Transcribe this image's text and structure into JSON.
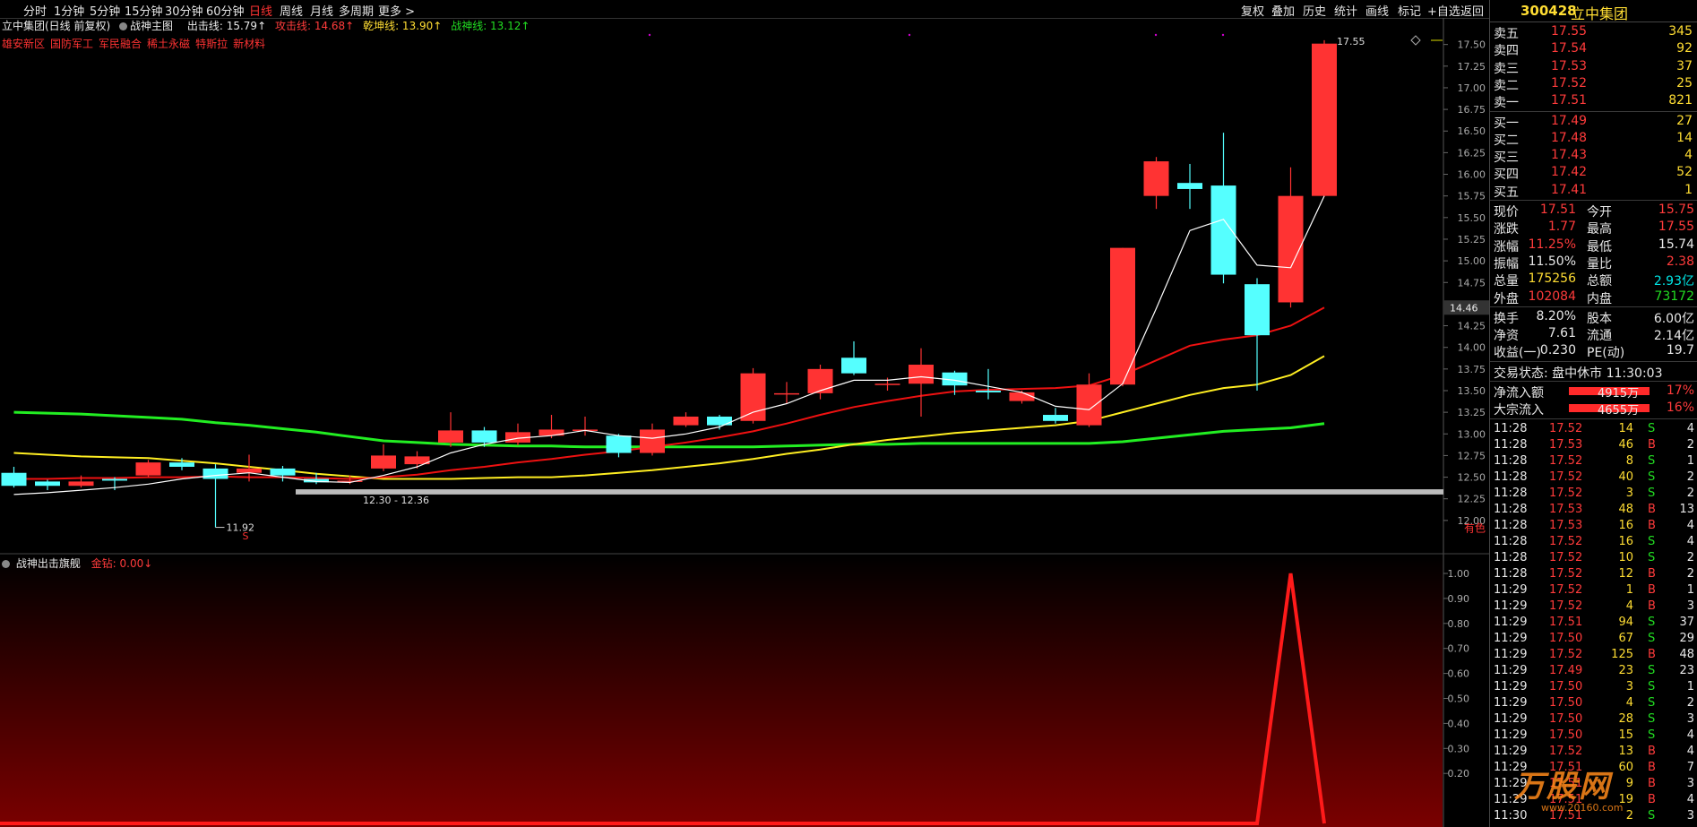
{
  "toolbar": {
    "tabs": [
      {
        "label": "分时",
        "active": false
      },
      {
        "label": "1分钟",
        "active": false
      },
      {
        "label": "5分钟",
        "active": false
      },
      {
        "label": "15分钟",
        "active": false
      },
      {
        "label": "30分钟",
        "active": false
      },
      {
        "label": "60分钟",
        "active": false
      },
      {
        "label": "日线",
        "active": true
      },
      {
        "label": "周线",
        "active": false
      },
      {
        "label": "月线",
        "active": false
      },
      {
        "label": "多周期",
        "active": false
      },
      {
        "label": "更多 >",
        "active": false
      }
    ],
    "tools": [
      "复权",
      "叠加",
      "历史",
      "统计",
      "画线",
      "标记",
      "+自选",
      "返回"
    ]
  },
  "main_chart": {
    "title": "立中集团(日线 前复权)",
    "indicator": "战神主图",
    "attack_label": "出击线: 15.79↑",
    "offense_label": "攻击线: 14.68↑",
    "qiankun_label": "乾坤线: 13.90↑",
    "zhanshen_label": "战神线: 13.12↑",
    "concepts": [
      "雄安新区",
      "国防军工",
      "军民融合",
      "稀土永磁",
      "特斯拉",
      "新材料"
    ],
    "high_label": "17.55",
    "low_label": "11.92",
    "range_label": "12.30 - 12.36",
    "current_tag": "14.46",
    "corner_label": "有色",
    "s_marker": "S"
  },
  "sub_chart": {
    "title": "战神出击旗舰",
    "value_label": "金钻: 0.00↓",
    "axis": [
      "1.00",
      "0.90",
      "0.80",
      "0.70",
      "0.60",
      "0.50",
      "0.40",
      "0.30",
      "0.20"
    ]
  },
  "colors": {
    "up": "#ff3333",
    "down": "#55ffff",
    "ma_white": "#ffffff",
    "ma_red": "#ee1111",
    "ma_yellow": "#ffee22",
    "ma_green": "#22ee22"
  },
  "chart_data": {
    "type": "candlestick",
    "ylim": [
      11.75,
      17.6
    ],
    "yticks": [
      "17.50",
      "17.25",
      "17.00",
      "16.75",
      "16.50",
      "16.25",
      "16.00",
      "15.75",
      "15.50",
      "15.25",
      "15.00",
      "14.75",
      "14.50",
      "14.25",
      "14.00",
      "13.75",
      "13.50",
      "13.25",
      "13.00",
      "12.75",
      "12.50",
      "12.25",
      "12.00"
    ],
    "candles": [
      {
        "o": 12.55,
        "c": 12.4,
        "h": 12.62,
        "l": 12.38
      },
      {
        "o": 12.45,
        "c": 12.4,
        "h": 12.47,
        "l": 12.35
      },
      {
        "o": 12.4,
        "c": 12.45,
        "h": 12.52,
        "l": 12.38
      },
      {
        "o": 12.48,
        "c": 12.46,
        "h": 12.5,
        "l": 12.35
      },
      {
        "o": 12.52,
        "c": 12.67,
        "h": 12.7,
        "l": 12.5
      },
      {
        "o": 12.67,
        "c": 12.62,
        "h": 12.72,
        "l": 12.58
      },
      {
        "o": 12.6,
        "c": 12.48,
        "h": 12.65,
        "l": 11.92
      },
      {
        "o": 12.55,
        "c": 12.6,
        "h": 12.76,
        "l": 12.45
      },
      {
        "o": 12.6,
        "c": 12.52,
        "h": 12.63,
        "l": 12.45
      },
      {
        "o": 12.48,
        "c": 12.44,
        "h": 12.55,
        "l": 12.42
      },
      {
        "o": 12.46,
        "c": 12.46,
        "h": 12.52,
        "l": 12.42
      },
      {
        "o": 12.6,
        "c": 12.75,
        "h": 12.88,
        "l": 12.57
      },
      {
        "o": 12.65,
        "c": 12.74,
        "h": 12.8,
        "l": 12.6
      },
      {
        "o": 12.9,
        "c": 13.04,
        "h": 13.25,
        "l": 12.85
      },
      {
        "o": 13.04,
        "c": 12.9,
        "h": 13.08,
        "l": 12.85
      },
      {
        "o": 12.9,
        "c": 13.02,
        "h": 13.12,
        "l": 12.87
      },
      {
        "o": 12.98,
        "c": 13.05,
        "h": 13.22,
        "l": 12.95
      },
      {
        "o": 13.05,
        "c": 13.05,
        "h": 13.2,
        "l": 12.98
      },
      {
        "o": 12.98,
        "c": 12.78,
        "h": 13.0,
        "l": 12.73
      },
      {
        "o": 12.78,
        "c": 13.05,
        "h": 13.12,
        "l": 12.75
      },
      {
        "o": 13.1,
        "c": 13.2,
        "h": 13.25,
        "l": 13.08
      },
      {
        "o": 13.2,
        "c": 13.1,
        "h": 13.22,
        "l": 13.05
      },
      {
        "o": 13.15,
        "c": 13.7,
        "h": 13.76,
        "l": 13.12
      },
      {
        "o": 13.47,
        "c": 13.47,
        "h": 13.6,
        "l": 13.35
      },
      {
        "o": 13.47,
        "c": 13.75,
        "h": 13.8,
        "l": 13.4
      },
      {
        "o": 13.88,
        "c": 13.7,
        "h": 14.07,
        "l": 13.68
      },
      {
        "o": 13.58,
        "c": 13.58,
        "h": 13.65,
        "l": 13.5
      },
      {
        "o": 13.58,
        "c": 13.8,
        "h": 13.99,
        "l": 13.2
      },
      {
        "o": 13.71,
        "c": 13.56,
        "h": 13.73,
        "l": 13.45
      },
      {
        "o": 13.5,
        "c": 13.48,
        "h": 13.75,
        "l": 13.4
      },
      {
        "o": 13.38,
        "c": 13.48,
        "h": 13.5,
        "l": 13.35
      },
      {
        "o": 13.22,
        "c": 13.15,
        "h": 13.3,
        "l": 13.12
      },
      {
        "o": 13.1,
        "c": 13.57,
        "h": 13.7,
        "l": 13.08
      },
      {
        "o": 13.57,
        "c": 15.15,
        "h": 15.15,
        "l": 13.55
      },
      {
        "o": 15.75,
        "c": 16.15,
        "h": 16.2,
        "l": 15.6
      },
      {
        "o": 15.9,
        "c": 15.83,
        "h": 16.12,
        "l": 15.6
      },
      {
        "o": 15.87,
        "c": 14.84,
        "h": 16.48,
        "l": 14.74
      },
      {
        "o": 14.73,
        "c": 14.14,
        "h": 14.8,
        "l": 13.5
      },
      {
        "o": 14.52,
        "c": 15.75,
        "h": 16.08,
        "l": 14.46
      },
      {
        "o": 15.75,
        "c": 17.51,
        "h": 17.55,
        "l": 15.74
      }
    ],
    "ma_white": [
      12.3,
      12.32,
      12.35,
      12.38,
      12.42,
      12.48,
      12.52,
      12.55,
      12.5,
      12.45,
      12.44,
      12.52,
      12.62,
      12.78,
      12.88,
      12.95,
      12.98,
      13.04,
      12.98,
      12.95,
      13.0,
      13.08,
      13.25,
      13.35,
      13.5,
      13.62,
      13.62,
      13.66,
      13.62,
      13.55,
      13.48,
      13.32,
      13.28,
      13.58,
      14.45,
      15.35,
      15.48,
      14.95,
      14.92,
      15.75
    ],
    "ma_red": [
      12.48,
      12.48,
      12.49,
      12.49,
      12.5,
      12.5,
      12.51,
      12.5,
      12.5,
      12.49,
      12.48,
      12.5,
      12.53,
      12.58,
      12.62,
      12.67,
      12.71,
      12.76,
      12.8,
      12.85,
      12.9,
      12.96,
      13.03,
      13.12,
      13.22,
      13.31,
      13.38,
      13.44,
      13.49,
      13.51,
      13.52,
      13.53,
      13.56,
      13.68,
      13.85,
      14.02,
      14.09,
      14.14,
      14.25,
      14.46
    ],
    "ma_yellow": [
      12.78,
      12.76,
      12.74,
      12.73,
      12.72,
      12.69,
      12.66,
      12.62,
      12.58,
      12.54,
      12.51,
      12.48,
      12.48,
      12.48,
      12.49,
      12.5,
      12.5,
      12.52,
      12.55,
      12.58,
      12.62,
      12.66,
      12.71,
      12.77,
      12.82,
      12.88,
      12.93,
      12.97,
      13.01,
      13.04,
      13.07,
      13.1,
      13.15,
      13.25,
      13.35,
      13.45,
      13.53,
      13.57,
      13.68,
      13.9
    ],
    "ma_green": [
      13.25,
      13.24,
      13.23,
      13.21,
      13.19,
      13.17,
      13.13,
      13.1,
      13.06,
      13.02,
      12.97,
      12.92,
      12.9,
      12.88,
      12.87,
      12.86,
      12.86,
      12.85,
      12.85,
      12.85,
      12.85,
      12.85,
      12.85,
      12.86,
      12.87,
      12.88,
      12.88,
      12.89,
      12.89,
      12.89,
      12.89,
      12.89,
      12.89,
      12.91,
      12.95,
      12.99,
      13.03,
      13.05,
      13.07,
      13.12
    ],
    "signal": [
      0,
      0,
      0,
      0,
      0,
      0,
      0,
      0,
      0,
      0,
      0,
      0,
      0,
      0,
      0,
      0,
      0,
      0,
      0,
      0,
      0,
      0,
      0,
      0,
      0,
      0,
      0,
      0,
      0,
      0,
      0,
      0,
      0,
      0,
      0,
      0,
      0,
      0,
      1,
      0
    ],
    "signal_ylim": [
      0,
      1.0
    ]
  },
  "stock": {
    "code": "300428",
    "name": "立中集团"
  },
  "order_book": {
    "sells": [
      {
        "label": "卖五",
        "price": "17.55",
        "vol": "345"
      },
      {
        "label": "卖四",
        "price": "17.54",
        "vol": "92"
      },
      {
        "label": "卖三",
        "price": "17.53",
        "vol": "37"
      },
      {
        "label": "卖二",
        "price": "17.52",
        "vol": "25"
      },
      {
        "label": "卖一",
        "price": "17.51",
        "vol": "821"
      }
    ],
    "buys": [
      {
        "label": "买一",
        "price": "17.49",
        "vol": "27"
      },
      {
        "label": "买二",
        "price": "17.48",
        "vol": "14"
      },
      {
        "label": "买三",
        "price": "17.43",
        "vol": "4"
      },
      {
        "label": "买四",
        "price": "17.42",
        "vol": "52"
      },
      {
        "label": "买五",
        "price": "17.41",
        "vol": "1"
      }
    ]
  },
  "quote": [
    {
      "l1": "现价",
      "v1": "17.51",
      "c1": "red",
      "l2": "今开",
      "v2": "15.75",
      "c2": "red"
    },
    {
      "l1": "涨跌",
      "v1": "1.77",
      "c1": "red",
      "l2": "最高",
      "v2": "17.55",
      "c2": "red"
    },
    {
      "l1": "涨幅",
      "v1": "11.25%",
      "c1": "red",
      "l2": "最低",
      "v2": "15.74",
      "c2": "wht"
    },
    {
      "l1": "振幅",
      "v1": "11.50%",
      "c1": "wht",
      "l2": "量比",
      "v2": "2.38",
      "c2": "red"
    },
    {
      "l1": "总量",
      "v1": "175256",
      "c1": "yel",
      "l2": "总额",
      "v2": "2.93亿",
      "c2": "cyn"
    },
    {
      "l1": "外盘",
      "v1": "102084",
      "c1": "red",
      "l2": "内盘",
      "v2": "73172",
      "c2": "grn"
    }
  ],
  "fundamentals": [
    {
      "l1": "换手",
      "v1": "8.20%",
      "l2": "股本",
      "v2": "6.00亿"
    },
    {
      "l1": "净资",
      "v1": "7.61",
      "l2": "流通",
      "v2": "2.14亿"
    },
    {
      "l1": "收益(一)",
      "v1": "0.230",
      "l2": "PE(动)",
      "v2": "19.7"
    }
  ],
  "trade_status": "交易状态: 盘中休市 11:30:03",
  "flows": [
    {
      "label": "净流入额",
      "value": "4915万",
      "pct": "17%"
    },
    {
      "label": "大宗流入",
      "value": "4655万",
      "pct": "16%"
    }
  ],
  "ticks": [
    {
      "t": "11:28",
      "p": "17.52",
      "v": "14",
      "s": "S",
      "n": "4"
    },
    {
      "t": "11:28",
      "p": "17.53",
      "v": "46",
      "s": "B",
      "n": "2"
    },
    {
      "t": "11:28",
      "p": "17.52",
      "v": "8",
      "s": "S",
      "n": "1"
    },
    {
      "t": "11:28",
      "p": "17.52",
      "v": "40",
      "s": "S",
      "n": "2"
    },
    {
      "t": "11:28",
      "p": "17.52",
      "v": "3",
      "s": "S",
      "n": "2"
    },
    {
      "t": "11:28",
      "p": "17.53",
      "v": "48",
      "s": "B",
      "n": "13"
    },
    {
      "t": "11:28",
      "p": "17.53",
      "v": "16",
      "s": "B",
      "n": "4"
    },
    {
      "t": "11:28",
      "p": "17.52",
      "v": "16",
      "s": "S",
      "n": "4"
    },
    {
      "t": "11:28",
      "p": "17.52",
      "v": "10",
      "s": "S",
      "n": "2"
    },
    {
      "t": "11:28",
      "p": "17.52",
      "v": "12",
      "s": "B",
      "n": "2"
    },
    {
      "t": "11:29",
      "p": "17.52",
      "v": "1",
      "s": "B",
      "n": "1"
    },
    {
      "t": "11:29",
      "p": "17.52",
      "v": "4",
      "s": "B",
      "n": "3"
    },
    {
      "t": "11:29",
      "p": "17.51",
      "v": "94",
      "s": "S",
      "n": "37"
    },
    {
      "t": "11:29",
      "p": "17.50",
      "v": "67",
      "s": "S",
      "n": "29"
    },
    {
      "t": "11:29",
      "p": "17.52",
      "v": "125",
      "s": "B",
      "n": "48"
    },
    {
      "t": "11:29",
      "p": "17.49",
      "v": "23",
      "s": "S",
      "n": "23"
    },
    {
      "t": "11:29",
      "p": "17.50",
      "v": "3",
      "s": "S",
      "n": "1"
    },
    {
      "t": "11:29",
      "p": "17.50",
      "v": "4",
      "s": "S",
      "n": "2"
    },
    {
      "t": "11:29",
      "p": "17.50",
      "v": "28",
      "s": "S",
      "n": "3"
    },
    {
      "t": "11:29",
      "p": "17.50",
      "v": "15",
      "s": "S",
      "n": "4"
    },
    {
      "t": "11:29",
      "p": "17.52",
      "v": "13",
      "s": "B",
      "n": "4"
    },
    {
      "t": "11:29",
      "p": "17.51",
      "v": "60",
      "s": "B",
      "n": "7"
    },
    {
      "t": "11:29",
      "p": "17.51",
      "v": "9",
      "s": "B",
      "n": "3"
    },
    {
      "t": "11:29",
      "p": "17.51",
      "v": "19",
      "s": "B",
      "n": "4"
    },
    {
      "t": "11:30",
      "p": "17.51",
      "v": "2",
      "s": "S",
      "n": "3"
    }
  ],
  "watermark": "万股网",
  "watermark_url": "www.20160.com"
}
